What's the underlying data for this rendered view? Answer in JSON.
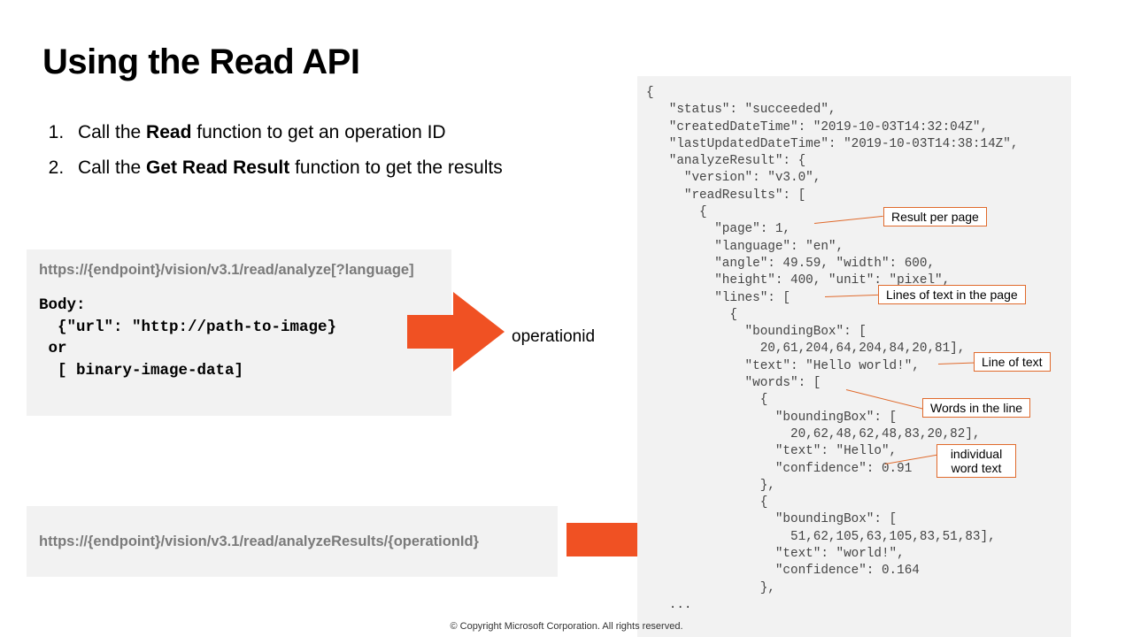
{
  "title": "Using the Read API",
  "steps": {
    "one_prefix": "Call the ",
    "one_bold": "Read",
    "one_suffix": " function to get an operation ID",
    "two_prefix": "Call the ",
    "two_bold": "Get Read Result",
    "two_suffix": " function to get the results"
  },
  "request1": {
    "endpoint": "https://{endpoint}/vision/v3.1/read/analyze[?language]",
    "body": "Body:\n  {\"url\": \"http://path-to-image}\n or\n  [ binary-image-data]"
  },
  "request2": {
    "endpoint": "https://{endpoint}/vision/v3.1/read/analyzeResults/{operationId}"
  },
  "operation_label": "operationid",
  "json_response": "{\n   \"status\": \"succeeded\",\n   \"createdDateTime\": \"2019-10-03T14:32:04Z\",\n   \"lastUpdatedDateTime\": \"2019-10-03T14:38:14Z\",\n   \"analyzeResult\": {\n     \"version\": \"v3.0\",\n     \"readResults\": [\n       {\n         \"page\": 1,\n         \"language\": \"en\",\n         \"angle\": 49.59, \"width\": 600,\n         \"height\": 400, \"unit\": \"pixel\",\n         \"lines\": [\n           {\n             \"boundingBox\": [\n               20,61,204,64,204,84,20,81],\n             \"text\": \"Hello world!\",\n             \"words\": [\n               {\n                 \"boundingBox\": [\n                   20,62,48,62,48,83,20,82],\n                 \"text\": \"Hello\",\n                 \"confidence\": 0.91\n               },\n               {\n                 \"boundingBox\": [\n                   51,62,105,63,105,83,51,83],\n                 \"text\": \"world!\",\n                 \"confidence\": 0.164\n               },\n   ...",
  "callouts": {
    "c1": "Result per page",
    "c2": "Lines of text in the page",
    "c3": "Line of text",
    "c4": "Words in the line",
    "c5": "individual\nword text"
  },
  "footer": "© Copyright Microsoft Corporation. All rights reserved."
}
